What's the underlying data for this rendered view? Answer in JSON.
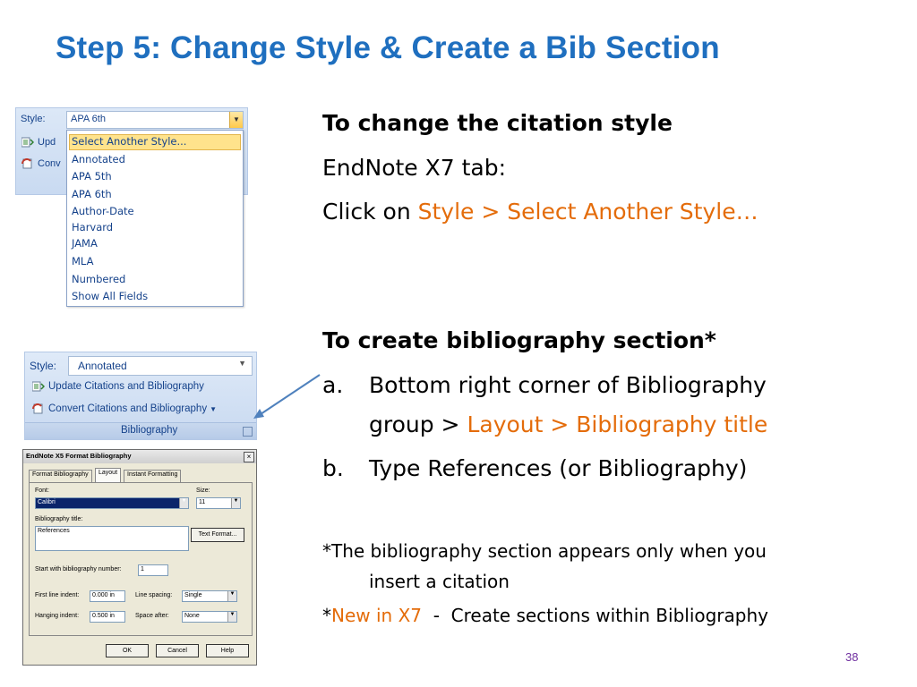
{
  "slide": {
    "title": "Step 5: Change Style & Create a Bib Section",
    "page_number": "38"
  },
  "content": {
    "h1": "To change the citation style",
    "line1": "EndNote X7 tab:",
    "line2_prefix": "Click on ",
    "line2_highlight": "Style > Select Another Style…",
    "h2": "To create bibliography section*",
    "a_marker": "a.",
    "a_line1": "Bottom right corner of Bibliography",
    "a_line2_prefix": "group > ",
    "a_line2_highlight": "Layout > Bibliography title",
    "b_marker": "b.",
    "b_text": "Type References (or Bibliography)",
    "note1_line1": "*The bibliography section appears only when  you",
    "note1_line2": "insert a citation",
    "note2_star": "*",
    "note2_highlight": "New in X7",
    "note2_rest": "  -  Create sections within Bibliography"
  },
  "shot1": {
    "style_label": "Style:",
    "style_value": "APA 6th",
    "row1": "Upd",
    "row2": "Conv",
    "items": [
      "Select Another Style...",
      "Annotated",
      "APA 5th",
      "APA 6th",
      "Author-Date",
      "Harvard",
      "JAMA",
      "MLA",
      "Numbered",
      "Show All Fields"
    ]
  },
  "shot2": {
    "style_label": "Style:",
    "style_value": "Annotated",
    "update": "Update Citations and Bibliography",
    "convert": "Convert Citations and Bibliography",
    "group_label": "Bibliography"
  },
  "dialog": {
    "title": "EndNote X5 Format Bibliography",
    "tabs": [
      "Format Bibliography",
      "Layout",
      "Instant Formatting"
    ],
    "font_label": "Font:",
    "font_value": "Calibri",
    "size_label": "Size:",
    "size_value": "11",
    "bib_title_label": "Bibliography title:",
    "bib_title_value": "References",
    "text_format_btn": "Text Format...",
    "start_label": "Start with bibliography number:",
    "start_value": "1",
    "first_indent_label": "First line indent:",
    "first_indent_value": "0.000 in",
    "line_spacing_label": "Line spacing:",
    "line_spacing_value": "Single",
    "hanging_label": "Hanging indent:",
    "hanging_value": "0.500 in",
    "space_after_label": "Space after:",
    "space_after_value": "None",
    "ok": "OK",
    "cancel": "Cancel",
    "help": "Help"
  },
  "colors": {
    "title": "#1f6fbf",
    "accent": "#e46c0a",
    "page_number": "#7030a0"
  }
}
